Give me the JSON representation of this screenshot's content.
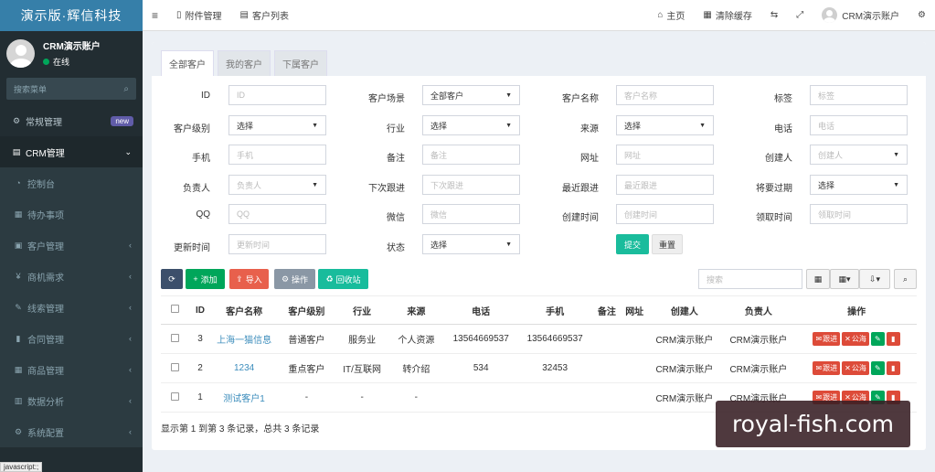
{
  "brand": "演示版·辉信科技",
  "user": {
    "name": "CRM演示账户",
    "status": "在线"
  },
  "sidebar": {
    "search_placeholder": "搜索菜单",
    "items": [
      {
        "label": "常规管理",
        "icon": "cogs-icon",
        "badge": "new"
      },
      {
        "label": "CRM管理",
        "icon": "id-card-icon",
        "arrow": "⌄"
      }
    ],
    "sub_items": [
      {
        "label": "控制台",
        "icon": "dashboard-icon"
      },
      {
        "label": "待办事项",
        "icon": "calendar-icon"
      },
      {
        "label": "客户管理",
        "icon": "address-card-icon",
        "arrow": "‹"
      },
      {
        "label": "商机需求",
        "icon": "yen-icon",
        "arrow": "‹"
      },
      {
        "label": "线索管理",
        "icon": "wrench-icon",
        "arrow": "‹"
      },
      {
        "label": "合同管理",
        "icon": "bookmark-icon",
        "arrow": "‹"
      },
      {
        "label": "商品管理",
        "icon": "grid-icon",
        "arrow": "‹"
      },
      {
        "label": "数据分析",
        "icon": "bar-chart-icon",
        "arrow": "‹"
      },
      {
        "label": "系统配置",
        "icon": "cogs-icon",
        "arrow": "‹"
      }
    ]
  },
  "status_bar_text": "javascript:;",
  "topbar": {
    "tabs": [
      {
        "label": "附件管理",
        "icon": "file-icon"
      },
      {
        "label": "客户列表",
        "icon": "list-icon"
      }
    ],
    "home": "主页",
    "clear_cache": "清除缓存",
    "account": "CRM演示账户"
  },
  "content_tabs": [
    "全部客户",
    "我的客户",
    "下属客户"
  ],
  "filters": [
    {
      "label": "ID",
      "type": "input",
      "placeholder": "ID"
    },
    {
      "label": "客户场景",
      "type": "select",
      "value": "全部客户"
    },
    {
      "label": "客户名称",
      "type": "input",
      "placeholder": "客户名称"
    },
    {
      "label": "标签",
      "type": "input",
      "placeholder": "标签"
    },
    {
      "label": "客户级别",
      "type": "select",
      "value": "选择"
    },
    {
      "label": "行业",
      "type": "select",
      "value": "选择"
    },
    {
      "label": "来源",
      "type": "select",
      "value": "选择"
    },
    {
      "label": "电话",
      "type": "input",
      "placeholder": "电话"
    },
    {
      "label": "手机",
      "type": "input",
      "placeholder": "手机"
    },
    {
      "label": "备注",
      "type": "input",
      "placeholder": "备注"
    },
    {
      "label": "网址",
      "type": "input",
      "placeholder": "网址"
    },
    {
      "label": "创建人",
      "type": "select",
      "value": "创建人",
      "muted": true
    },
    {
      "label": "负责人",
      "type": "select",
      "value": "负责人",
      "muted": true
    },
    {
      "label": "下次跟进",
      "type": "input",
      "placeholder": "下次跟进"
    },
    {
      "label": "最近跟进",
      "type": "input",
      "placeholder": "最近跟进"
    },
    {
      "label": "将要过期",
      "type": "select",
      "value": "选择"
    },
    {
      "label": "QQ",
      "type": "input",
      "placeholder": "QQ"
    },
    {
      "label": "微信",
      "type": "input",
      "placeholder": "微信"
    },
    {
      "label": "创建时间",
      "type": "input",
      "placeholder": "创建时间"
    },
    {
      "label": "领取时间",
      "type": "input",
      "placeholder": "领取时间"
    },
    {
      "label": "更新时间",
      "type": "input",
      "placeholder": "更新时间"
    },
    {
      "label": "状态",
      "type": "select",
      "value": "选择"
    }
  ],
  "form_buttons": {
    "submit": "提交",
    "reset": "重置"
  },
  "toolbar": {
    "add": "添加",
    "import": "导入",
    "operate": "操作",
    "recycle": "回收站",
    "search_placeholder": "搜索"
  },
  "table": {
    "headers": [
      "ID",
      "客户名称",
      "客户级别",
      "行业",
      "来源",
      "电话",
      "手机",
      "备注",
      "网址",
      "创建人",
      "负责人",
      "操作"
    ],
    "rows": [
      [
        "3",
        "上海一猫信息",
        "普通客户",
        "服务业",
        "个人资源",
        "13564669537",
        "13564669537",
        "",
        "",
        "CRM演示账户",
        "CRM演示账户"
      ],
      [
        "2",
        "1234",
        "重点客户",
        "IT/互联网",
        "转介绍",
        "534",
        "32453",
        "",
        "",
        "CRM演示账户",
        "CRM演示账户"
      ],
      [
        "1",
        "测试客户1",
        "-",
        "-",
        "-",
        "",
        "",
        "",
        "",
        "CRM演示账户",
        "CRM演示账户"
      ]
    ],
    "row_actions": {
      "follow": "跟进",
      "public": "公海"
    }
  },
  "footer": "显示第 1 到第 3 条记录，总共 3 条记录",
  "watermark": "royal-fish.com",
  "colors": {
    "primary": "#3c8dbc",
    "success": "#00a65a",
    "danger": "#dd4b39",
    "teal": "#1abc9c",
    "sidebar": "#222d32"
  }
}
